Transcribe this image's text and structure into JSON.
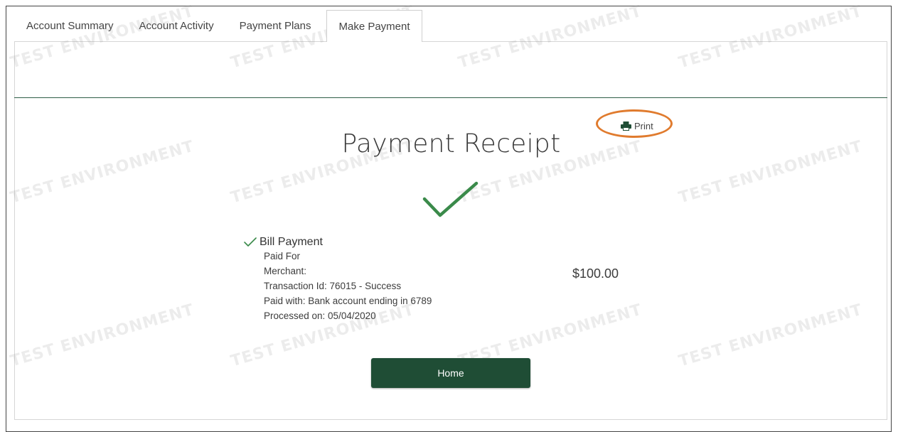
{
  "tabs": [
    {
      "label": "Account Summary"
    },
    {
      "label": "Account Activity"
    },
    {
      "label": "Payment Plans"
    },
    {
      "label": "Make Payment"
    }
  ],
  "watermark": "TEST ENVIRONMENT",
  "receipt": {
    "title": "Payment Receipt",
    "print_label": "Print",
    "payment_type": "Bill Payment",
    "paid_for_label": "Paid For",
    "merchant_label": "Merchant:",
    "transaction": "Transaction Id: 76015 - Success",
    "paid_with": "Paid with: Bank account ending in 6789",
    "processed_on": "Processed on: 05/04/2020",
    "amount": "$100.00"
  },
  "home_button": "Home",
  "colors": {
    "brand_green": "#1f4d35",
    "check_green": "#3a8a4a",
    "highlight": "#e07b2e"
  },
  "icons": {
    "print": "printer-icon",
    "success": "checkmark-icon"
  }
}
